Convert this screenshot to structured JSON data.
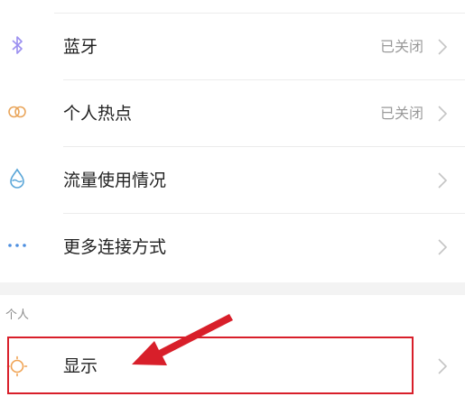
{
  "colors": {
    "bluetooth": "#9b8ff0",
    "hotspot": "#e9a55b",
    "data_usage": "#5aa6d8",
    "more": "#4d8fe0",
    "display": "#f0a455",
    "highlight": "#d81f2a",
    "chevron": "#c4c4c4"
  },
  "settings_rows": [
    {
      "label": "蓝牙",
      "status": "已关闭",
      "icon": "bluetooth-icon"
    },
    {
      "label": "个人热点",
      "status": "已关闭",
      "icon": "hotspot-icon"
    },
    {
      "label": "流量使用情况",
      "status": "",
      "icon": "data-usage-icon"
    },
    {
      "label": "更多连接方式",
      "status": "",
      "icon": "more-icon"
    }
  ],
  "personal_section": {
    "header": "个人",
    "display_row": {
      "label": "显示",
      "icon": "display-icon"
    }
  }
}
